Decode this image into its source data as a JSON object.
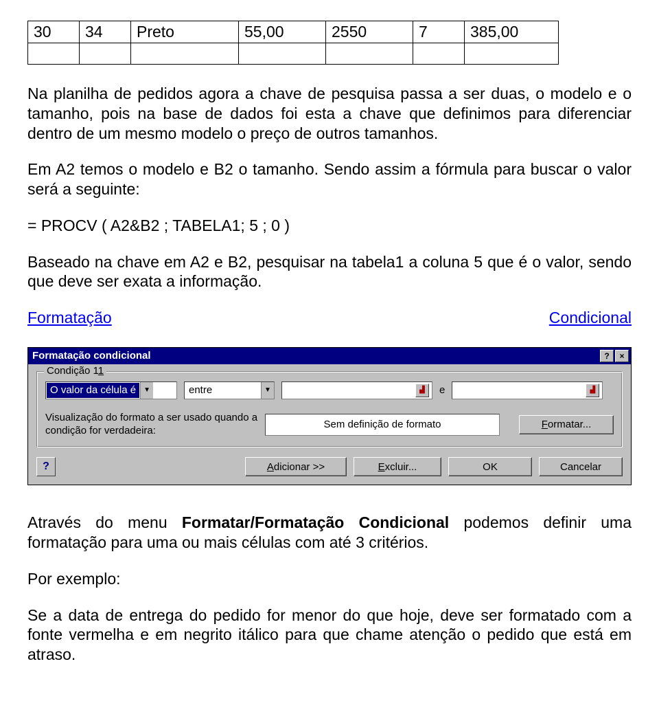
{
  "table": {
    "rows": [
      [
        "30",
        "34",
        "Preto",
        "55,00",
        "2550",
        "7",
        "385,00"
      ],
      [
        "",
        "",
        "",
        "",
        "",
        "",
        ""
      ]
    ]
  },
  "paragraphs": {
    "p1": "Na planilha de pedidos agora a chave de pesquisa passa a ser duas, o modelo e o tamanho, pois na base de dados foi esta a chave que definimos para diferenciar dentro de um mesmo modelo o preço de outros tamanhos.",
    "p2": "Em A2 temos o modelo e B2 o tamanho. Sendo assim a fórmula para buscar o valor será a seguinte:",
    "formula": "= PROCV ( A2&B2 ; TABELA1; 5 ; 0 )",
    "p3": "Baseado na chave em A2 e B2, pesquisar na tabela1 a coluna 5 que é o valor, sendo que deve ser exata a informação.",
    "section_left": "Formatação",
    "section_right": "Condicional",
    "p4_pre": "Através do menu ",
    "p4_bold": "Formatar/Formatação Condicional",
    "p4_post": " podemos definir uma formatação para uma ou mais células com até 3 critérios.",
    "p5": "Por exemplo:",
    "p6": "Se a data de entrega do pedido for menor do que hoje, deve ser formatado com a fonte vermelha e em negrito itálico para que chame atenção  o pedido que está em atraso."
  },
  "dialog": {
    "title": "Formatação condicional",
    "help_btn": "?",
    "close_btn": "×",
    "group_label": "Condição 1",
    "combo_cellvalue": "O valor da célula é",
    "combo_between": "entre",
    "between_e": "e",
    "viz_label": "Visualização do formato a ser usado quando a condição for verdadeira:",
    "preview_text": "Sem definição de formato",
    "btn_format": "Formatar...",
    "btn_format_u": "F",
    "btn_add": "Adicionar >>",
    "btn_add_u": "A",
    "btn_delete": "Excluir...",
    "btn_delete_u": "E",
    "btn_ok": "OK",
    "btn_cancel": "Cancelar",
    "help_icon": "?"
  }
}
